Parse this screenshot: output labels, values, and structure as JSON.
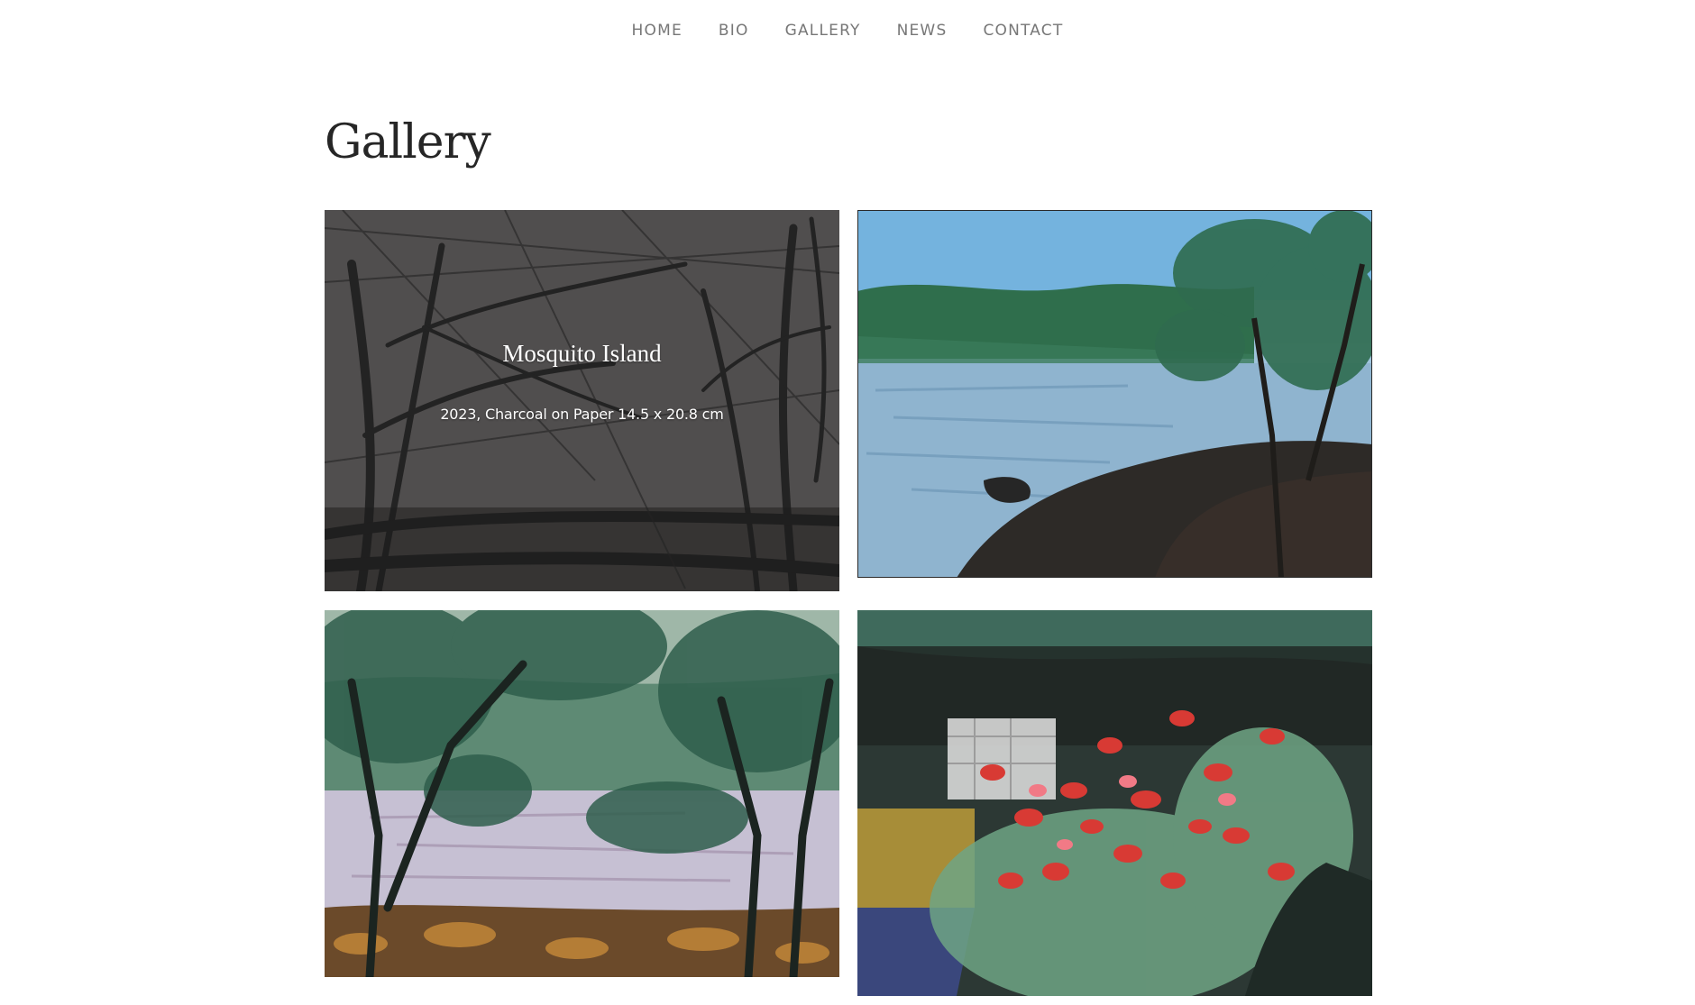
{
  "nav": {
    "items": [
      {
        "label": "HOME"
      },
      {
        "label": "BIO"
      },
      {
        "label": "GALLERY"
      },
      {
        "label": "NEWS"
      },
      {
        "label": "CONTACT"
      }
    ]
  },
  "page": {
    "title": "Gallery"
  },
  "gallery": {
    "items": [
      {
        "title": "Mosquito Island",
        "caption": "2023, Charcoal on Paper 14.5 x 20.8 cm",
        "medium": "charcoal",
        "palette": [
          "#5d5a5a",
          "#1f1f1f",
          "#3a3838"
        ]
      },
      {
        "medium": "pastel",
        "palette": [
          "#7fb6d8",
          "#2f6b4f",
          "#2a2521"
        ]
      },
      {
        "medium": "pastel",
        "palette": [
          "#c7c3d2",
          "#2f5e4c",
          "#8a5a2a"
        ]
      },
      {
        "medium": "pastel",
        "palette": [
          "#2d3a35",
          "#d63a36",
          "#7fa58a"
        ]
      }
    ]
  }
}
